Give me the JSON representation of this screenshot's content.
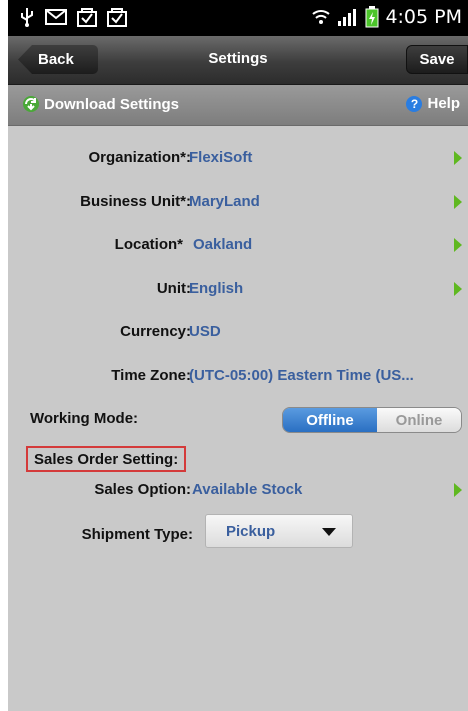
{
  "status_bar": {
    "time": "4:05 PM",
    "icons": [
      "usb-icon",
      "mail-icon",
      "download-done-icon",
      "download-done-icon",
      "wifi-icon",
      "signal-icon",
      "battery-icon"
    ]
  },
  "nav": {
    "title": "Settings",
    "back_label": "Back",
    "save_label": "Save"
  },
  "subheader": {
    "download_label": "Download Settings",
    "help_label": "Help",
    "help_glyph": "?"
  },
  "fields": {
    "organization": {
      "label": "Organization*:",
      "value": "FlexiSoft"
    },
    "business_unit": {
      "label": "Business Unit*:",
      "value": "MaryLand"
    },
    "location": {
      "label": "Location*",
      "value": "Oakland"
    },
    "unit": {
      "label": "Unit:",
      "value": "English"
    },
    "currency": {
      "label": "Currency:",
      "value": "USD"
    },
    "time_zone": {
      "label": "Time Zone:",
      "value": "(UTC-05:00) Eastern Time (US..."
    },
    "working_mode": {
      "label": "Working Mode:",
      "option_on": "Offline",
      "option_off": "Online",
      "selected": "Offline"
    }
  },
  "sales_section": {
    "title": "Sales Order Setting:",
    "sales_option": {
      "label": "Sales Option:",
      "value": "Available Stock"
    },
    "shipment_type": {
      "label": "Shipment Type:",
      "value": "Pickup"
    }
  },
  "colors": {
    "value_text": "#3a5f9e",
    "chevron": "#5fb820",
    "toggle_active": "#2a6fc2",
    "highlight_box": "#d43a3a"
  }
}
